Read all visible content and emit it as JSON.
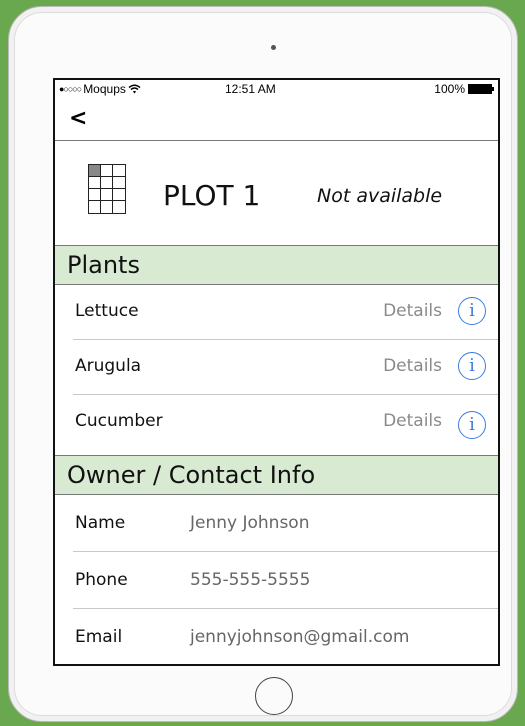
{
  "status_bar": {
    "carrier": "Moqups",
    "time": "12:51 AM",
    "battery": "100%"
  },
  "nav": {
    "back_icon": "chevron-left-icon",
    "back_glyph": "<"
  },
  "plot": {
    "title": "PLOT 1",
    "status": "Not available",
    "icon": "plot-grid-icon"
  },
  "plants_section": {
    "title": "Plants",
    "items": [
      {
        "name": "Lettuce",
        "details_label": "Details"
      },
      {
        "name": "Arugula",
        "details_label": "Details"
      },
      {
        "name": "Cucumber",
        "details_label": "Details"
      }
    ]
  },
  "contact_section": {
    "title": "Owner / Contact Info",
    "fields": [
      {
        "label": "Name",
        "value": "Jenny Johnson"
      },
      {
        "label": "Phone",
        "value": "555-555-5555"
      },
      {
        "label": "Email",
        "value": "jennyjohnson@gmail.com"
      }
    ]
  },
  "colors": {
    "background": "#6aa84f",
    "section_header": "#d9ead3",
    "info_icon": "#3b7ddd"
  }
}
